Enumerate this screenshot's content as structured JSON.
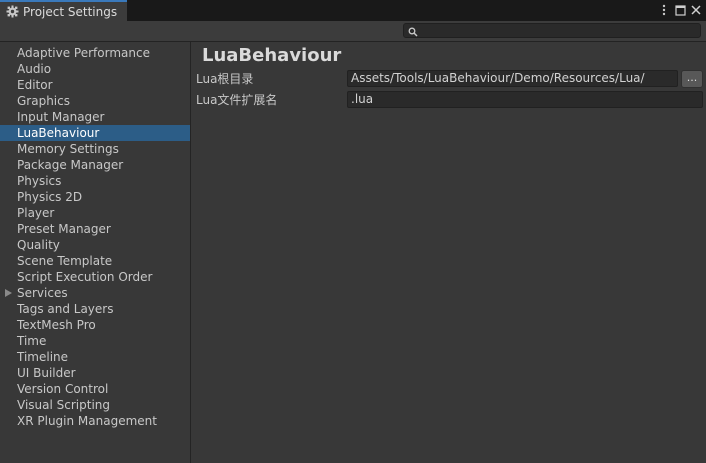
{
  "window": {
    "tab_title": "Project Settings",
    "tab_icon": "gear-icon",
    "controls": [
      "more-options-icon",
      "maximize-icon",
      "close-icon"
    ]
  },
  "search": {
    "value": "",
    "placeholder": ""
  },
  "sidebar": {
    "items": [
      {
        "label": "Adaptive Performance"
      },
      {
        "label": "Audio"
      },
      {
        "label": "Editor"
      },
      {
        "label": "Graphics"
      },
      {
        "label": "Input Manager"
      },
      {
        "label": "LuaBehaviour",
        "selected": true
      },
      {
        "label": "Memory Settings"
      },
      {
        "label": "Package Manager"
      },
      {
        "label": "Physics"
      },
      {
        "label": "Physics 2D"
      },
      {
        "label": "Player"
      },
      {
        "label": "Preset Manager"
      },
      {
        "label": "Quality"
      },
      {
        "label": "Scene Template"
      },
      {
        "label": "Script Execution Order"
      },
      {
        "label": "Services",
        "has_children": true
      },
      {
        "label": "Tags and Layers"
      },
      {
        "label": "TextMesh Pro"
      },
      {
        "label": "Time"
      },
      {
        "label": "Timeline"
      },
      {
        "label": "UI Builder"
      },
      {
        "label": "Version Control"
      },
      {
        "label": "Visual Scripting"
      },
      {
        "label": "XR Plugin Management"
      }
    ]
  },
  "main": {
    "title": "LuaBehaviour",
    "fields": [
      {
        "label": "Lua根目录",
        "value": "Assets/Tools/LuaBehaviour/Demo/Resources/Lua/",
        "browse_label": "..."
      },
      {
        "label": "Lua文件扩展名",
        "value": ".lua"
      }
    ]
  },
  "colors": {
    "background": "#383838",
    "selection": "#2c5d87",
    "tab_accent": "#3a79bb"
  }
}
